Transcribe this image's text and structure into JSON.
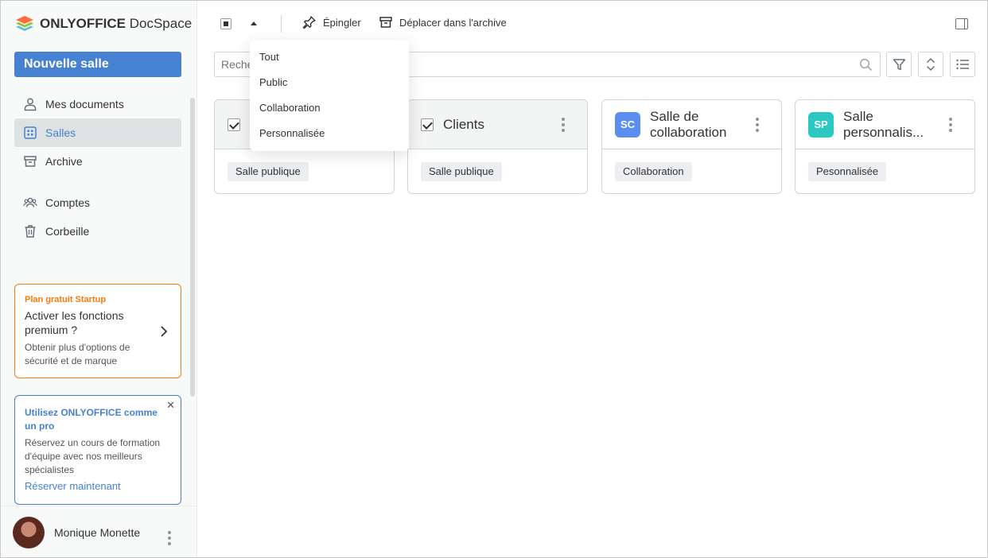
{
  "app": {
    "logo_bold": "ONLYOFFICE",
    "logo_light": "DocSpace"
  },
  "sidebar": {
    "new_room_label": "Nouvelle salle",
    "items": [
      {
        "label": "Mes documents",
        "icon": "user-icon"
      },
      {
        "label": "Salles",
        "icon": "rooms-grid-icon",
        "active": true
      },
      {
        "label": "Archive",
        "icon": "archive-icon"
      },
      {
        "label": "Comptes",
        "icon": "accounts-icon"
      },
      {
        "label": "Corbeille",
        "icon": "trash-icon"
      }
    ],
    "promo_plan": {
      "tag": "Plan gratuit Startup",
      "title": "Activer les fonctions premium ?",
      "text": "Obtenir plus d'options de sécurité et de marque"
    },
    "promo_training": {
      "title": "Utilisez ONLYOFFICE comme un pro",
      "text": "Réservez un cours de formation d'équipe avec nos meilleurs spécialistes",
      "link": "Réserver maintenant"
    },
    "user": {
      "name": "Monique Monette"
    }
  },
  "toolbar": {
    "pin_label": "Épingler",
    "archive_label": "Déplacer dans l'archive"
  },
  "search": {
    "placeholder": "Rechercher"
  },
  "dropdown": {
    "items": [
      "Tout",
      "Public",
      "Collaboration",
      "Personnalisée"
    ]
  },
  "rooms": [
    {
      "title": "",
      "tag": "Salle publique",
      "selected": true
    },
    {
      "title": "Clients",
      "tag": "Salle publique",
      "selected": true
    },
    {
      "title": "Salle de collaboration",
      "badge": "SC",
      "badge_color": "#5c8ef2",
      "tag": "Collaboration",
      "selected": false
    },
    {
      "title": "Salle personnalis...",
      "badge": "SP",
      "badge_color": "#2ec8c2",
      "tag": "Pesonnalisée",
      "selected": false
    }
  ],
  "colors": {
    "accent": "#4781d1",
    "promo_orange": "#f97a0b"
  }
}
